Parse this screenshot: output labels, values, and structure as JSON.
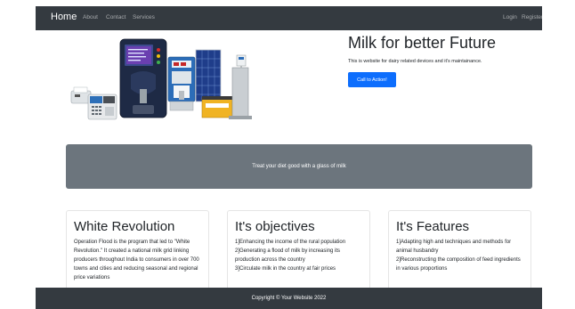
{
  "navbar": {
    "brand": "Home",
    "links": [
      "About",
      "Contact",
      "Services"
    ],
    "login": "Login",
    "register": "Register"
  },
  "hero": {
    "title": "Milk for better Future",
    "description": "This is website for dairy related devices and it's maintainance.",
    "cta_label": "Call to Action!",
    "image_icon": "dairy-equipment-image"
  },
  "banner": {
    "text": "Treat your diet good with a glass of milk"
  },
  "cards": [
    {
      "title": "White Revolution",
      "text": "Operation Flood is the program that led to \"White Revolution.\" It created a national milk grid linking producers throughout India to consumers in over 700 towns and cities and reducing seasonal and regional price variations"
    },
    {
      "title": "It's objectives",
      "text": "1]Enhancing the income of the rural population\n2]Generating a flood of milk by increasing its production across the country\n3]Circulate milk in the country at fair prices"
    },
    {
      "title": "It's Features",
      "text": "1]Adapting high and techniques and methods for animal husbandry\n2]Reconstructing the composition of feed ingredients in various proportions"
    }
  ],
  "footer": {
    "text": "Copyright © Your Website 2022"
  },
  "colors": {
    "navbar_bg": "#343a40",
    "primary": "#0d6efd",
    "banner_bg": "#6c757d"
  }
}
